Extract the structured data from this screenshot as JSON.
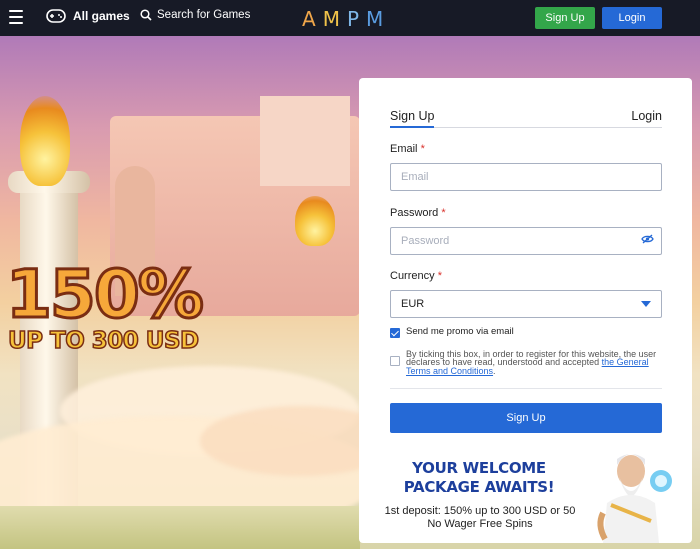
{
  "header": {
    "all_games": "All games",
    "search": "Search for Games",
    "logo": [
      "A",
      "M",
      "P",
      "M"
    ],
    "signup": "Sign Up",
    "login": "Login"
  },
  "hero": {
    "headline": "150%",
    "subline": "UP TO 300 USD"
  },
  "modal": {
    "close": "×",
    "tabs": {
      "signup": "Sign Up",
      "login": "Login"
    },
    "email": {
      "label": "Email",
      "required": "*",
      "placeholder": "Email"
    },
    "password": {
      "label": "Password",
      "required": "*",
      "placeholder": "Password"
    },
    "currency": {
      "label": "Currency",
      "required": "*",
      "value": "EUR"
    },
    "promo_checkbox": {
      "text": "Send me promo via email",
      "checked": true
    },
    "terms_checkbox": {
      "text": "By ticking this box, in order to register for this website, the user declares to have read, understood and accepted",
      "link": "the General Terms and Conditions",
      "end": ".",
      "checked": false
    },
    "submit": "Sign Up",
    "welcome_line1": "YOUR WELCOME",
    "welcome_line2": "PACKAGE AWAITS!",
    "deposit_line1": "1st deposit: 150% up to 300 USD or 50",
    "deposit_line2": "No Wager Free Spins"
  },
  "colors": {
    "accent_blue": "#2569d6",
    "green": "#33a64a",
    "topbar": "#171a26",
    "required": "#d9312b"
  },
  "icons": [
    "menu-icon",
    "gamepad-icon",
    "search-icon",
    "eye-off-icon",
    "chevron-down-icon",
    "close-icon"
  ]
}
